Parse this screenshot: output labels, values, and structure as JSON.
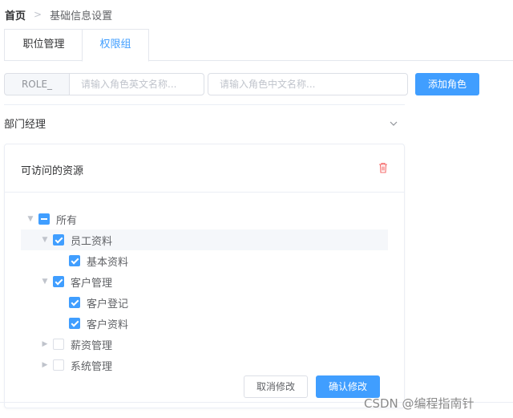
{
  "breadcrumb": {
    "home": "首页",
    "current": "基础信息设置"
  },
  "tabs": [
    {
      "label": "职位管理"
    },
    {
      "label": "权限组"
    }
  ],
  "role_form": {
    "prefix": "ROLE_",
    "en_placeholder": "请输入角色英文名称...",
    "zh_placeholder": "请输入角色中文名称...",
    "add_button": "添加角色"
  },
  "role": {
    "name": "部门经理"
  },
  "card": {
    "title": "可访问的资源"
  },
  "tree": [
    {
      "label": "所有",
      "state": "indeterminate",
      "expanded": true
    },
    {
      "label": "员工资料",
      "state": "checked",
      "expanded": true
    },
    {
      "label": "基本资料",
      "state": "checked"
    },
    {
      "label": "客户管理",
      "state": "checked",
      "expanded": true
    },
    {
      "label": "客户登记",
      "state": "checked"
    },
    {
      "label": "客户资料",
      "state": "checked"
    },
    {
      "label": "薪资管理",
      "state": "unchecked",
      "expanded": false
    },
    {
      "label": "系统管理",
      "state": "unchecked",
      "expanded": false
    }
  ],
  "actions": {
    "cancel": "取消修改",
    "confirm": "确认修改"
  },
  "watermark": "CSDN @编程指南针",
  "colors": {
    "primary": "#409eff",
    "danger": "#f56c6c",
    "border": "#dcdfe6"
  }
}
